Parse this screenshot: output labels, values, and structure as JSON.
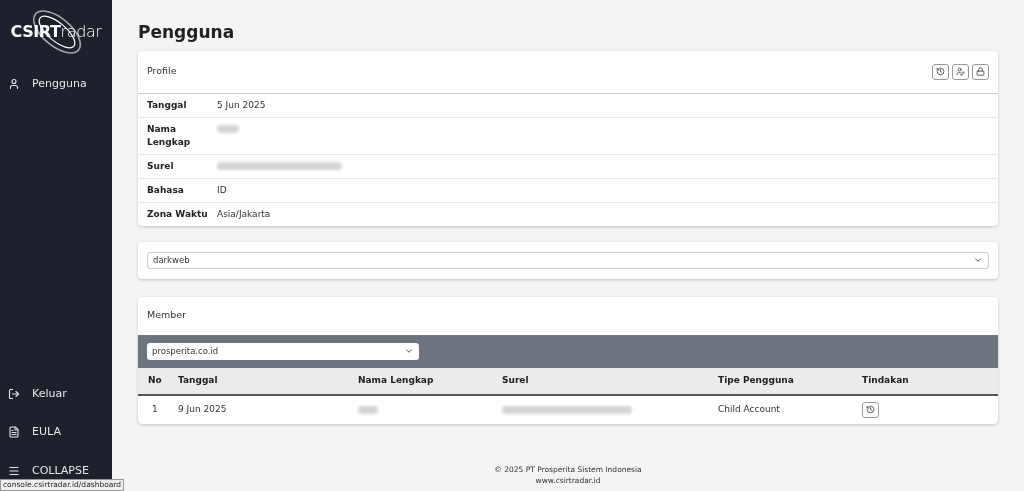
{
  "sidebar": {
    "logo": {
      "bold": "CSIRT",
      "light": "radar"
    },
    "items": [
      {
        "label": "Pengguna"
      }
    ],
    "bottom_items": [
      {
        "label": "Keluar"
      },
      {
        "label": "EULA"
      },
      {
        "label": "COLLAPSE"
      }
    ]
  },
  "page_title": "Pengguna",
  "profile": {
    "title": "Profile",
    "rows": [
      {
        "label": "Tanggal",
        "value": "5 Jun 2025",
        "redacted": false
      },
      {
        "label": "Nama Lengkap",
        "redacted": true
      },
      {
        "label": "Surel",
        "redacted": true
      },
      {
        "label": "Bahasa",
        "value": "ID",
        "redacted": false
      },
      {
        "label": "Zona Waktu",
        "value": "Asia/Jakarta",
        "redacted": false
      }
    ]
  },
  "service_select": {
    "value": "darkweb"
  },
  "member": {
    "title": "Member",
    "domain_select": {
      "value": "prosperita.co.id"
    },
    "columns": [
      "No",
      "Tanggal",
      "Nama Lengkap",
      "Surel",
      "Tipe Pengguna",
      "Tindakan"
    ],
    "rows": [
      {
        "no": "1",
        "date": "9 Jun 2025",
        "name_redacted": true,
        "email_redacted": true,
        "type": "Child Account"
      }
    ]
  },
  "footer": [
    "© 2025 PT Prosperita Sistem Indonesia",
    "www.csirtradar.id"
  ],
  "status_url": "console.csirtradar.id/dashboard"
}
